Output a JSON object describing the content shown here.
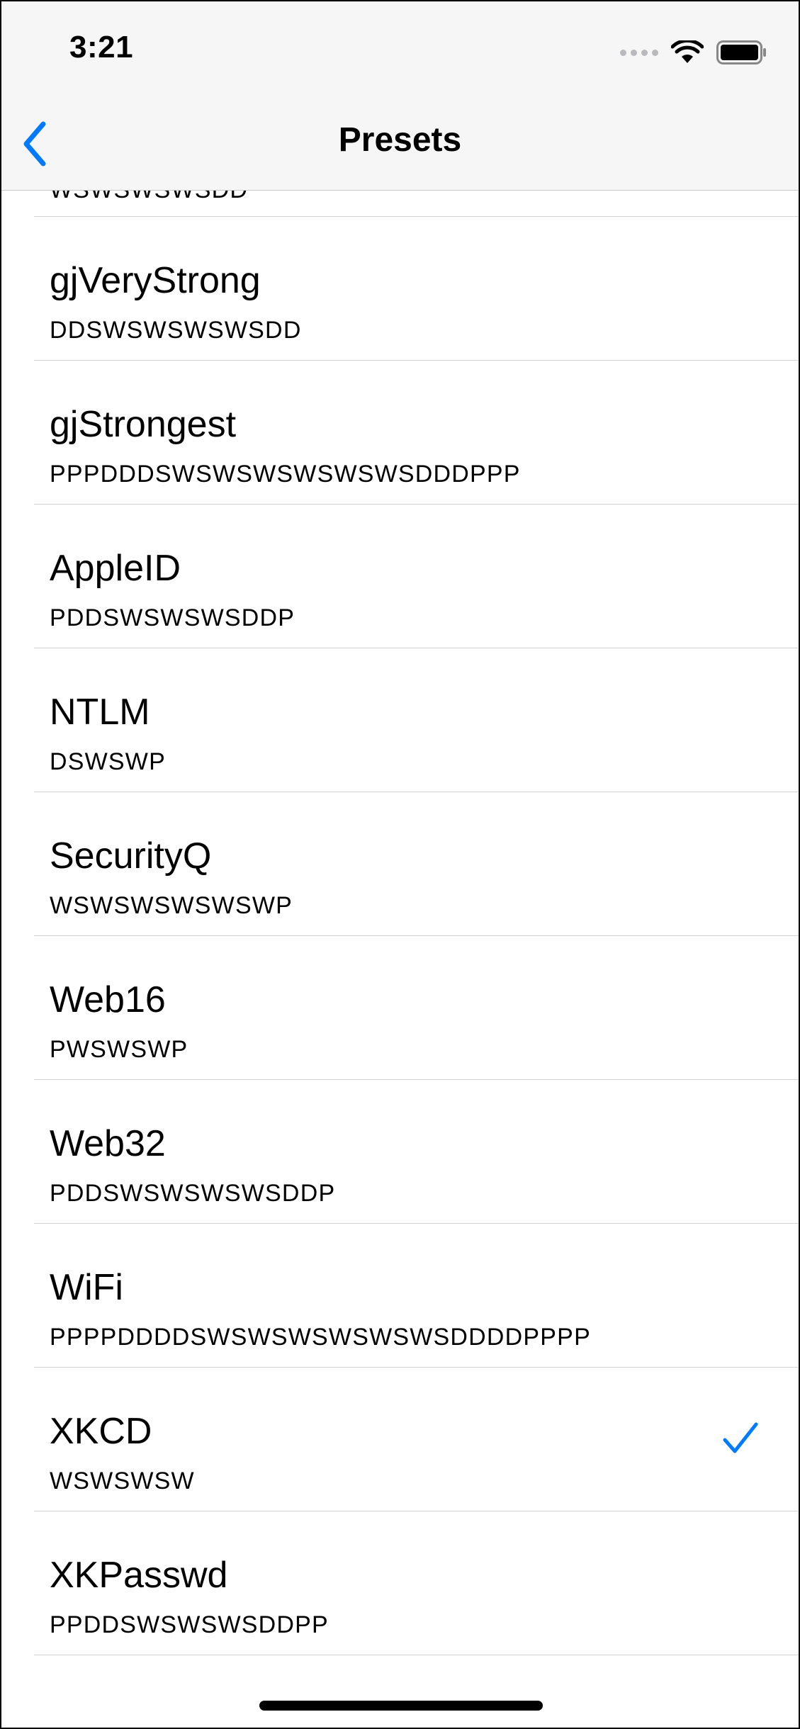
{
  "status_bar": {
    "time": "3:21"
  },
  "nav": {
    "title": "Presets",
    "back_icon": "chevron-left-icon"
  },
  "colors": {
    "accent": "#007aff",
    "nav_background": "#f6f6f6",
    "separator": "#d1d1d6"
  },
  "presets": {
    "partial_pattern": "WSWSWSWSDD",
    "items": [
      {
        "name": "gjVeryStrong",
        "pattern": "DDSWSWSWSWSDD",
        "selected": false
      },
      {
        "name": "gjStrongest",
        "pattern": "PPPDDDSWSWSWSWSWSWSDDDPPP",
        "selected": false
      },
      {
        "name": "AppleID",
        "pattern": "PDDSWSWSWSDDP",
        "selected": false
      },
      {
        "name": "NTLM",
        "pattern": "DSWSWP",
        "selected": false
      },
      {
        "name": "SecurityQ",
        "pattern": "WSWSWSWSWSWP",
        "selected": false
      },
      {
        "name": "Web16",
        "pattern": "PWSWSWP",
        "selected": false
      },
      {
        "name": "Web32",
        "pattern": "PDDSWSWSWSWSDDP",
        "selected": false
      },
      {
        "name": "WiFi",
        "pattern": "PPPPDDDDSWSWSWSWSWSWSDDDDPPPP",
        "selected": false
      },
      {
        "name": "XKCD",
        "pattern": "WSWSWSW",
        "selected": true
      },
      {
        "name": "XKPasswd",
        "pattern": "PPDDSWSWSWSDDPP",
        "selected": false
      }
    ]
  }
}
